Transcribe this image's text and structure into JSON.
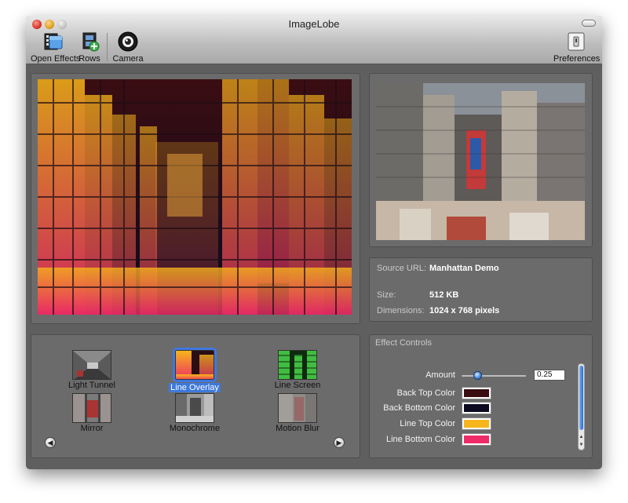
{
  "window": {
    "title": "ImageLobe"
  },
  "toolbar": {
    "open_effects": "Open Effects",
    "rows": "Rows",
    "camera": "Camera",
    "preferences": "Preferences"
  },
  "info": {
    "source_url_label": "Source URL:",
    "source_url_value": "Manhattan Demo",
    "size_label": "Size:",
    "size_value": "512 KB",
    "dimensions_label": "Dimensions:",
    "dimensions_value": "1024 x 768 pixels"
  },
  "effects": [
    {
      "label": "Light Tunnel"
    },
    {
      "label": "Line Overlay",
      "selected": true
    },
    {
      "label": "Line Screen"
    },
    {
      "label": "Mirror"
    },
    {
      "label": "Monochrome"
    },
    {
      "label": "Motion Blur"
    }
  ],
  "controls": {
    "title": "Effect Controls",
    "amount_label": "Amount",
    "amount_value": "0.25",
    "amount_fraction": 0.25,
    "back_top_color_label": "Back Top Color",
    "back_top_color": "#3a0d12",
    "back_bottom_color_label": "Back Bottom Color",
    "back_bottom_color": "#0c0a1f",
    "line_top_color_label": "Line Top Color",
    "line_top_color": "#f6b51a",
    "line_bottom_color_label": "Line Bottom Color",
    "line_bottom_color": "#ef2a68"
  }
}
